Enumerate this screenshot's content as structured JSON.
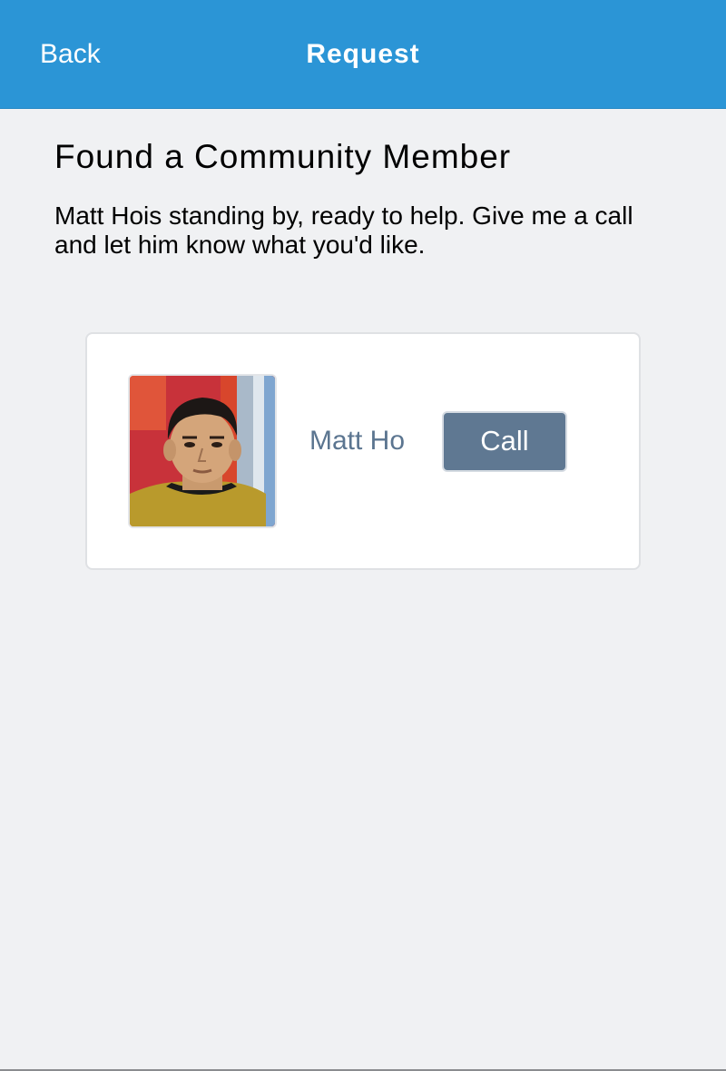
{
  "header": {
    "back_label": "Back",
    "title": "Request"
  },
  "main": {
    "title": "Found a Community Member",
    "message": "Matt Hois standing by, ready to help. Give me a call and let him know what you'd like."
  },
  "member_card": {
    "name": "Matt Ho",
    "call_label": "Call",
    "avatar_icon": "member-photo"
  },
  "colors": {
    "header_bg": "#2b95d6",
    "page_bg": "#f0f1f3",
    "call_button_bg": "#5f7892",
    "member_name": "#5b7590"
  }
}
